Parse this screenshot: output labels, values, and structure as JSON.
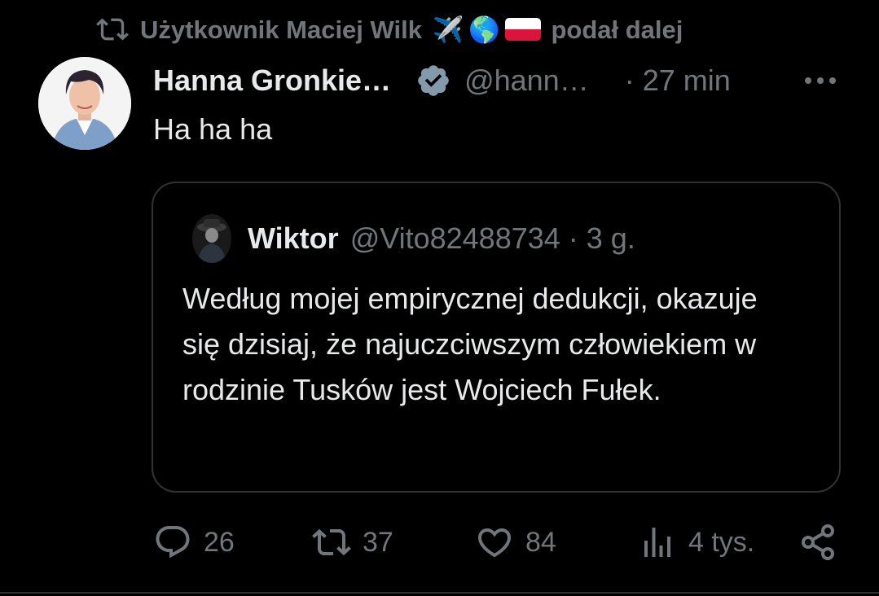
{
  "repost": {
    "icon": "repost-icon",
    "prefix": "Użytkownik Maciej Wilk",
    "emojis": [
      "✈️",
      "🌎"
    ],
    "flag": "flag-poland",
    "suffix": "podał dalej"
  },
  "post": {
    "author_name": "Hanna Gronkie…",
    "verified": true,
    "handle": "@hann…",
    "time": "· 27 min",
    "more_icon": "more-icon",
    "text": "Ha ha ha"
  },
  "quote": {
    "author_name": "Wiktor",
    "handle": "@Vito82488734 · 3 g.",
    "text": "Według mojej empirycznej dedukcji, okazuje się dzisiaj, że najuczciwszym człowiekiem w rodzinie Tusków jest Wojciech Fułek."
  },
  "actions": {
    "replies": "26",
    "reposts": "37",
    "likes": "84",
    "views": "4 tys."
  },
  "colors": {
    "background": "#000000",
    "text": "#e7e9ea",
    "muted": "#71767b",
    "border": "#2f3336",
    "verified": "#829aab"
  }
}
